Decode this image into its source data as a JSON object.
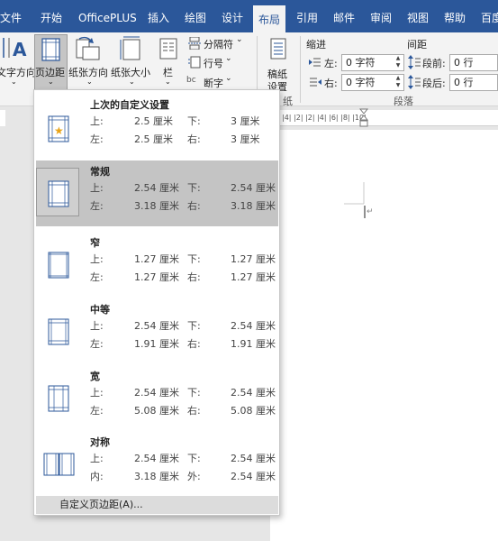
{
  "tabs": [
    {
      "label": "文件"
    },
    {
      "label": "开始"
    },
    {
      "label": "OfficePLUS"
    },
    {
      "label": "插入"
    },
    {
      "label": "绘图"
    },
    {
      "label": "设计"
    },
    {
      "label": "布局"
    },
    {
      "label": "引用"
    },
    {
      "label": "邮件"
    },
    {
      "label": "审阅"
    },
    {
      "label": "视图"
    },
    {
      "label": "帮助"
    },
    {
      "label": "百度"
    }
  ],
  "ribbon": {
    "text_direction": "文字方向",
    "margins": "页边距",
    "orientation": "纸张方向",
    "size": "纸张大小",
    "columns": "栏",
    "breaks": "分隔符",
    "line_numbers": "行号",
    "hyphenation": "断字",
    "draft_paper_line1": "稿纸",
    "draft_paper_line2": "设置",
    "draft_group": "纸",
    "indent_title": "缩进",
    "indent_left_label": "左:",
    "indent_left_value": "0 字符",
    "indent_right_label": "右:",
    "indent_right_value": "0 字符",
    "spacing_title": "间距",
    "spacing_before_label": "段前:",
    "spacing_before_value": "0 行",
    "spacing_after_label": "段后:",
    "spacing_after_value": "0 行",
    "paragraph_group": "段落"
  },
  "ruler_text": "|6|  |4|  |2|      |2|  |4|  |6|  |8|  |10|",
  "margins_menu": {
    "options": [
      {
        "name": "上次的自定义设置",
        "k1": "上:",
        "v1": "2.5 厘米",
        "k2": "下:",
        "v2": "3 厘米",
        "k3": "左:",
        "v3": "2.5 厘米",
        "k4": "右:",
        "v4": "3 厘米"
      },
      {
        "name": "常规",
        "k1": "上:",
        "v1": "2.54 厘米",
        "k2": "下:",
        "v2": "2.54 厘米",
        "k3": "左:",
        "v3": "3.18 厘米",
        "k4": "右:",
        "v4": "3.18 厘米"
      },
      {
        "name": "窄",
        "k1": "上:",
        "v1": "1.27 厘米",
        "k2": "下:",
        "v2": "1.27 厘米",
        "k3": "左:",
        "v3": "1.27 厘米",
        "k4": "右:",
        "v4": "1.27 厘米"
      },
      {
        "name": "中等",
        "k1": "上:",
        "v1": "2.54 厘米",
        "k2": "下:",
        "v2": "2.54 厘米",
        "k3": "左:",
        "v3": "1.91 厘米",
        "k4": "右:",
        "v4": "1.91 厘米"
      },
      {
        "name": "宽",
        "k1": "上:",
        "v1": "2.54 厘米",
        "k2": "下:",
        "v2": "2.54 厘米",
        "k3": "左:",
        "v3": "5.08 厘米",
        "k4": "右:",
        "v4": "5.08 厘米"
      },
      {
        "name": "对称",
        "k1": "上:",
        "v1": "2.54 厘米",
        "k2": "下:",
        "v2": "2.54 厘米",
        "k3": "内:",
        "v3": "3.18 厘米",
        "k4": "外:",
        "v4": "2.54 厘米"
      }
    ],
    "custom_label": "自定义页边距(A)..."
  },
  "colors": {
    "accent": "#2b579a",
    "selected": "#c4c4c4"
  }
}
